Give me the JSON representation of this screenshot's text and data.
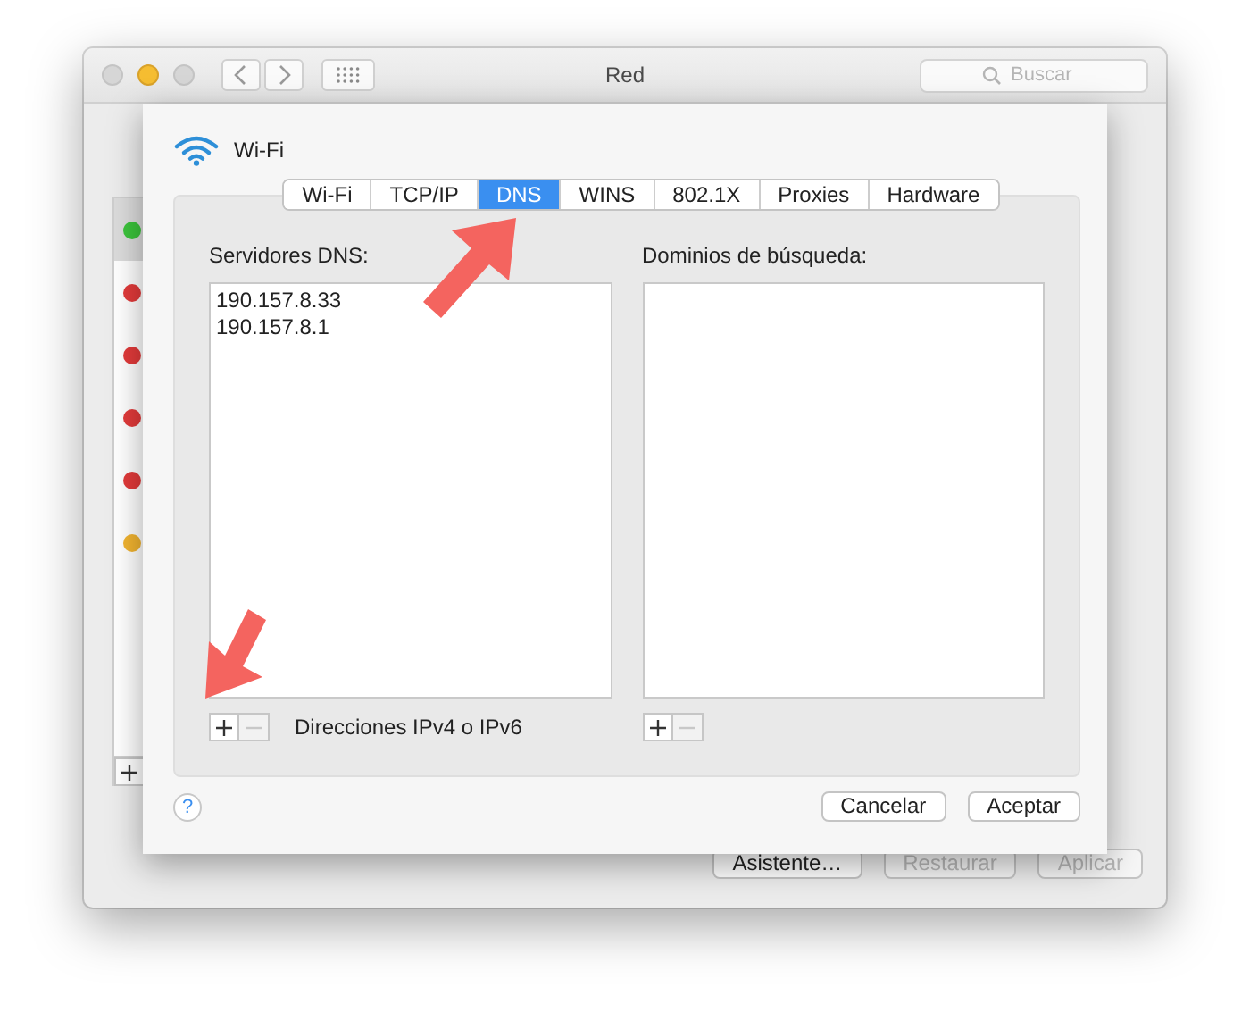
{
  "window": {
    "title": "Red",
    "search": {
      "placeholder": "Buscar"
    }
  },
  "sidebar": {
    "items": [
      {
        "color": "#3cc43c",
        "selected": true
      },
      {
        "color": "#e23a3a",
        "selected": false
      },
      {
        "color": "#e23a3a",
        "selected": false
      },
      {
        "color": "#e23a3a",
        "selected": false
      },
      {
        "color": "#e23a3a",
        "selected": false
      },
      {
        "color": "#f2b430",
        "selected": false
      }
    ]
  },
  "sheet": {
    "service": "Wi-Fi",
    "tabs": [
      {
        "label": "Wi-Fi",
        "selected": false
      },
      {
        "label": "TCP/IP",
        "selected": false
      },
      {
        "label": "DNS",
        "selected": true
      },
      {
        "label": "WINS",
        "selected": false
      },
      {
        "label": "802.1X",
        "selected": false
      },
      {
        "label": "Proxies",
        "selected": false
      },
      {
        "label": "Hardware",
        "selected": false
      }
    ],
    "dns_servers": {
      "label": "Servidores DNS:",
      "entries": [
        "190.157.8.33",
        "190.157.8.1"
      ],
      "hint": "Direcciones IPv4 o IPv6"
    },
    "search_domains": {
      "label": "Dominios de búsqueda:"
    },
    "buttons": [
      "Cancelar",
      "Aceptar"
    ],
    "help": "?"
  },
  "footer_buttons": [
    {
      "label": "Asistente…",
      "disabled": false
    },
    {
      "label": "Restaurar",
      "disabled": true
    },
    {
      "label": "Aplicar",
      "disabled": true
    }
  ]
}
